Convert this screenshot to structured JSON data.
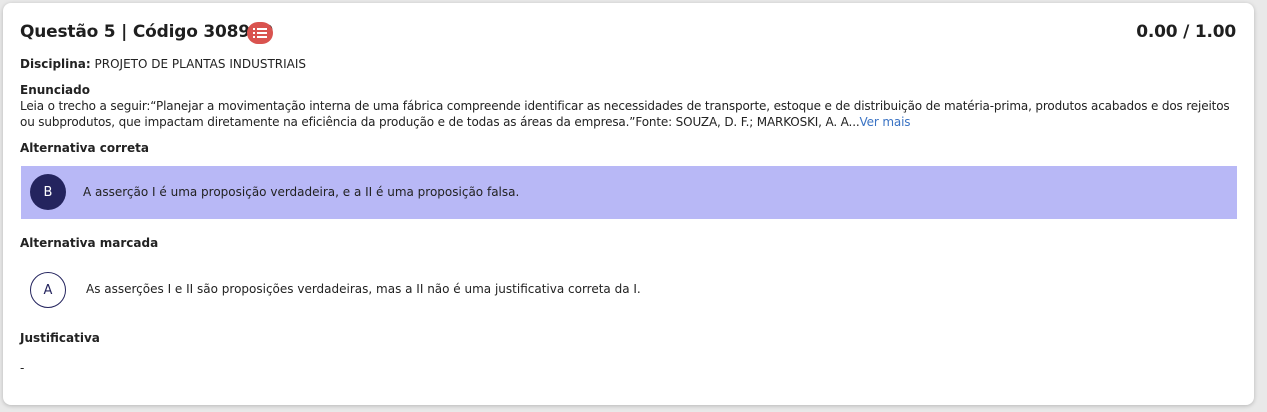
{
  "header": {
    "title": "Questão 5 | Código 308910",
    "list_icon": "list-icon",
    "score": "0.00 / 1.00"
  },
  "disciplina": {
    "label": "Disciplina:",
    "value": "PROJETO DE PLANTAS INDUSTRIAIS"
  },
  "enunciado": {
    "label": "Enunciado",
    "text": "Leia o trecho a seguir:“Planejar a movimentação interna de uma fábrica compreende identificar as necessidades de transporte, estoque e de distribuição de matéria-prima, produtos acabados e dos rejeitos ou subprodutos, que impactam diretamente na eficiência da produção e de todas as áreas da empresa.”Fonte: SOUZA, D. F.; MARKOSKI, A. A...",
    "ver_mais": "Ver mais"
  },
  "alternativa_correta": {
    "label": "Alternativa correta",
    "letter": "B",
    "text": "A asserção I é uma proposição verdadeira, e a II é uma proposição falsa."
  },
  "alternativa_marcada": {
    "label": "Alternativa marcada",
    "letter": "A",
    "text": "As asserções I e II são proposições verdadeiras, mas a II não é uma justificativa correta da I."
  },
  "justificativa": {
    "label": "Justificativa",
    "value": "-"
  },
  "colors": {
    "correct_bg": "#b8b8f6",
    "circle_dark": "#24245e",
    "icon_red": "#d9534f",
    "link_blue": "#3a73c4"
  }
}
